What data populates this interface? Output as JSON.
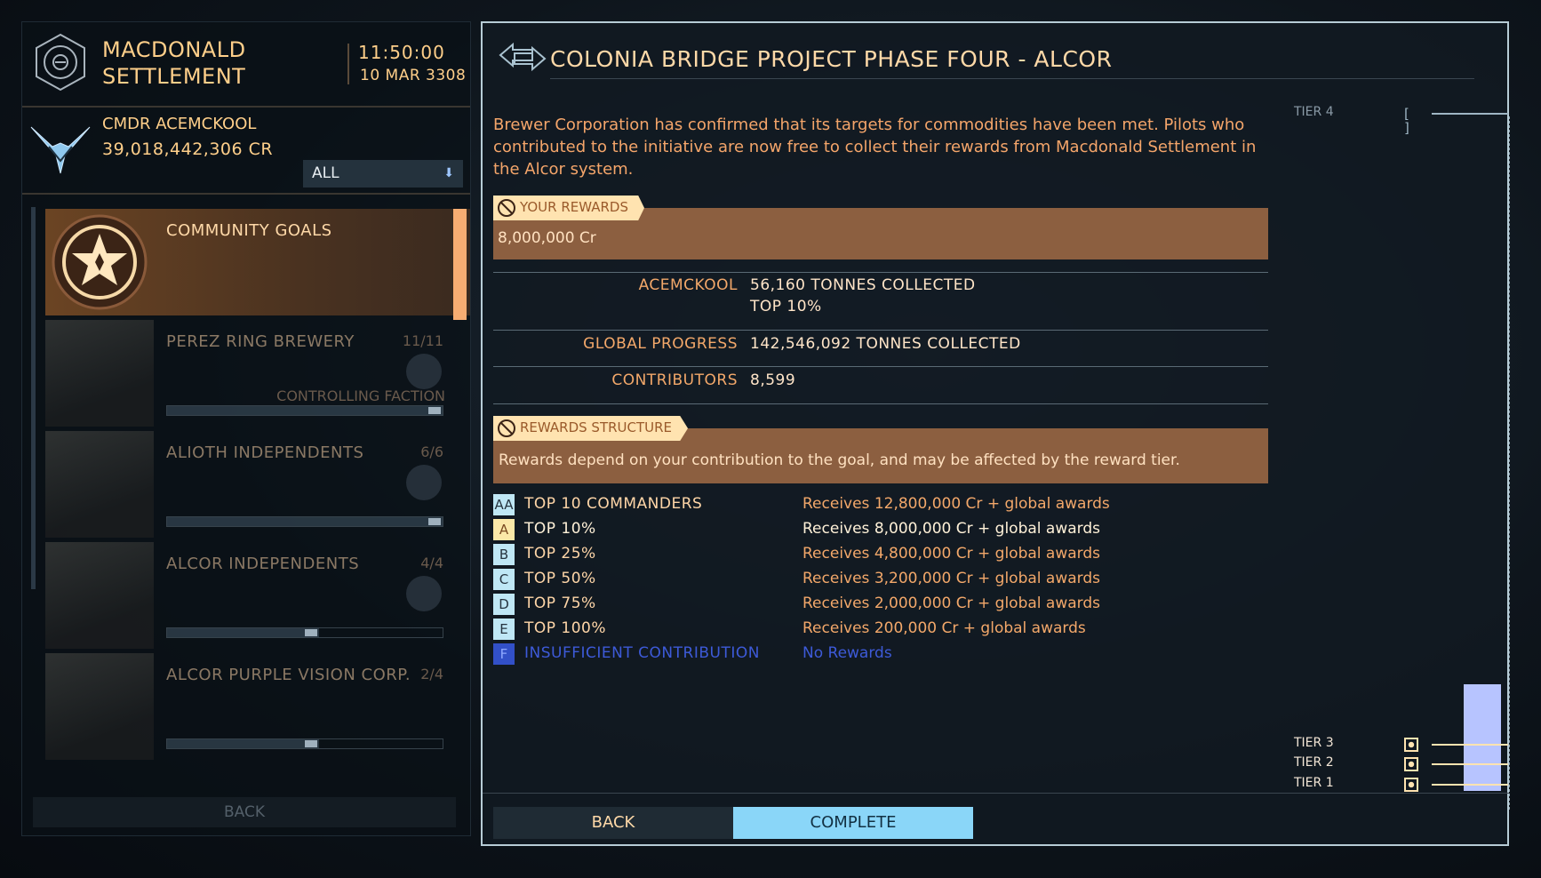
{
  "station": {
    "name_line1": "MACDONALD",
    "name_line2": "SETTLEMENT",
    "time": "11:50:00",
    "date": "10 MAR 3308"
  },
  "commander": {
    "name": "CMDR ACEMCKOOL",
    "credits": "39,018,442,306 CR"
  },
  "filter": {
    "selected": "ALL"
  },
  "goals": [
    {
      "name": "COMMUNITY GOALS",
      "count": "",
      "sub": "",
      "progress": null,
      "selected": true
    },
    {
      "name": "PEREZ RING BREWERY",
      "count": "11/11",
      "sub": "CONTROLLING FACTION",
      "progress": 1.0
    },
    {
      "name": "ALIOTH INDEPENDENTS",
      "count": "6/6",
      "sub": "",
      "progress": 1.0
    },
    {
      "name": "ALCOR INDEPENDENTS",
      "count": "4/4",
      "sub": "",
      "progress": 0.55
    },
    {
      "name": "ALCOR PURPLE VISION CORP.",
      "count": "2/4",
      "sub": "",
      "progress": 0.55
    }
  ],
  "left_back": "BACK",
  "detail": {
    "title": "COLONIA BRIDGE PROJECT PHASE FOUR - ALCOR",
    "description": "Brewer Corporation has confirmed that its targets for commodities have been met. Pilots who contributed to the initiative are now free to collect their rewards from Macdonald Settlement in the Alcor system.",
    "your_rewards_tab": "YOUR REWARDS",
    "reward_amount": "8,000,000 Cr",
    "stats": {
      "player_label": "ACEMCKOOL",
      "player_line1": "56,160 TONNES COLLECTED",
      "player_line2": "TOP 10%",
      "global_label": "GLOBAL PROGRESS",
      "global_value": "142,546,092 TONNES COLLECTED",
      "contributors_label": "CONTRIBUTORS",
      "contributors_value": "8,599"
    },
    "structure_tab": "REWARDS STRUCTURE",
    "structure_text": "Rewards depend on your contribution to the goal, and may be affected by the reward tier.",
    "tiers": [
      {
        "badge": "AA",
        "label": "TOP 10 COMMANDERS",
        "reward": "Receives 12,800,000 Cr + global awards"
      },
      {
        "badge": "A",
        "label": "TOP 10%",
        "reward": "Receives 8,000,000 Cr + global awards"
      },
      {
        "badge": "B",
        "label": "TOP 25%",
        "reward": "Receives 4,800,000 Cr + global awards"
      },
      {
        "badge": "C",
        "label": "TOP 50%",
        "reward": "Receives 3,200,000 Cr + global awards"
      },
      {
        "badge": "D",
        "label": "TOP 75%",
        "reward": "Receives 2,000,000 Cr + global awards"
      },
      {
        "badge": "E",
        "label": "TOP 100%",
        "reward": "Receives 200,000 Cr + global awards"
      },
      {
        "badge": "F",
        "label": "INSUFFICIENT CONTRIBUTION",
        "reward": "No Rewards"
      }
    ],
    "tier_gauge": {
      "tier4": "TIER 4",
      "tier3": "TIER 3",
      "tier2": "TIER 2",
      "tier1": "TIER 1",
      "reached_tier": 3
    },
    "buttons": {
      "back": "BACK",
      "complete": "COMPLETE"
    }
  },
  "colors": {
    "accent_orange": "#f3a86a",
    "cyan": "#8ad6f8",
    "reward_bg": "#8c5f40"
  }
}
